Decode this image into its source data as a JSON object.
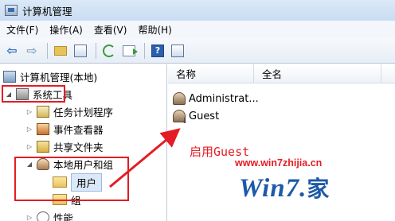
{
  "window": {
    "title": "计算机管理"
  },
  "menu": [
    "文件(F)",
    "操作(A)",
    "查看(V)",
    "帮助(H)"
  ],
  "toolbar": {
    "icons": [
      "back-arrow-icon",
      "forward-arrow-icon",
      "up-folder-icon",
      "show-hide-tree-icon",
      "refresh-icon",
      "export-list-icon",
      "help-icon",
      "action-pane-icon"
    ]
  },
  "tree": {
    "root": "计算机管理(本地)",
    "system_tools": "系统工具",
    "task_scheduler": "任务计划程序",
    "event_viewer": "事件查看器",
    "shared_folders": "共享文件夹",
    "local_users_groups": "本地用户和组",
    "users": "用户",
    "groups": "组",
    "performance": "性能"
  },
  "list": {
    "headers": [
      "名称",
      "全名"
    ],
    "rows": [
      {
        "name": "Administrat..."
      },
      {
        "name": "Guest"
      }
    ]
  },
  "annotation": {
    "text": "启用Guest",
    "color": "#e41c23"
  },
  "watermark": {
    "url": "www.win7zhijia.cn",
    "logo": "Win7.",
    "logo_char": "家"
  }
}
